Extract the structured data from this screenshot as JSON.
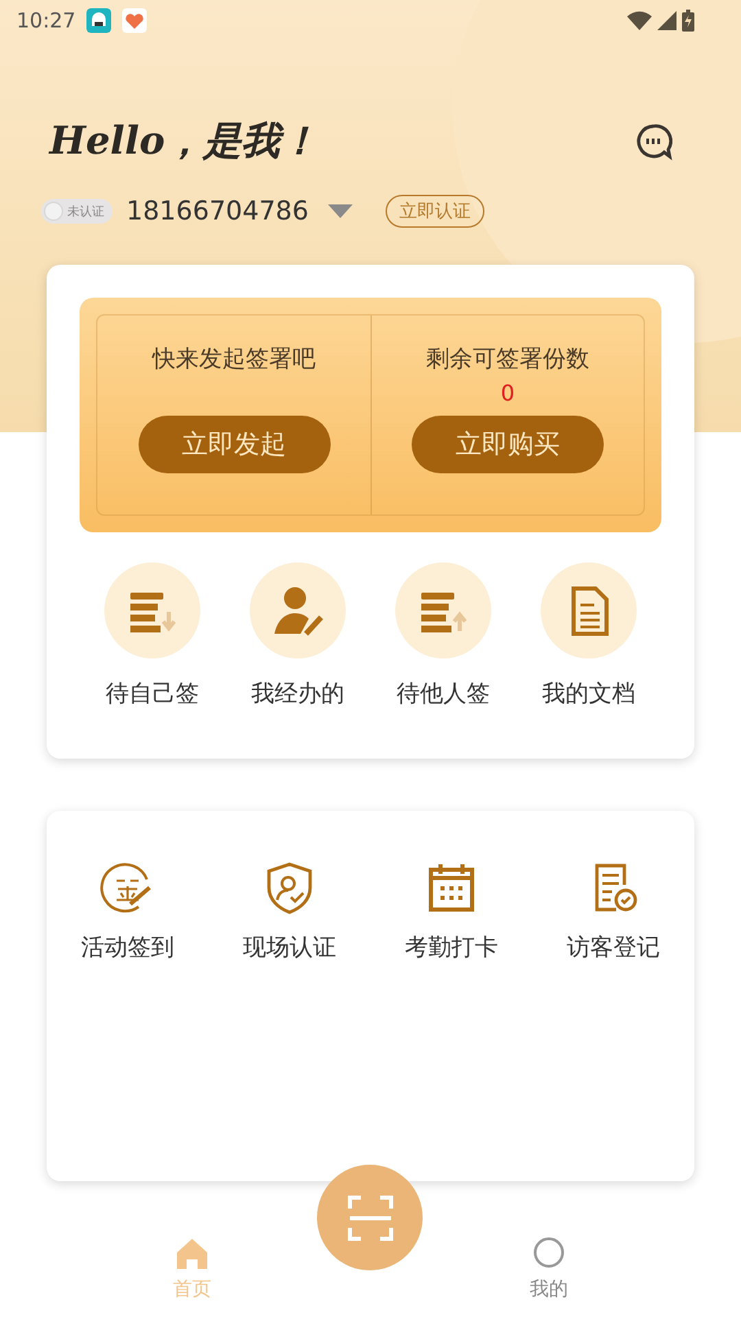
{
  "status_bar": {
    "time": "10:27"
  },
  "greeting": "Hello，是我！",
  "account": {
    "status_badge": "未认证",
    "verified": false,
    "phone": "18166704786",
    "verify_button": "立即认证"
  },
  "sign_panel": [
    {
      "kind": "start",
      "prompt": "快来发起签署吧",
      "button": "立即发起"
    },
    {
      "kind": "quota",
      "prompt": "剩余可签署份数",
      "count": "0",
      "button": "立即购买"
    }
  ],
  "quick_actions": [
    {
      "kind": "sign-in",
      "label": "待自己签"
    },
    {
      "kind": "handled",
      "label": "我经办的"
    },
    {
      "kind": "sign-out",
      "label": "待他人签"
    },
    {
      "kind": "doc",
      "label": "我的文档"
    }
  ],
  "services": [
    {
      "kind": "checkin",
      "label": "活动签到"
    },
    {
      "kind": "verify",
      "label": "现场认证"
    },
    {
      "kind": "calendar",
      "label": "考勤打卡"
    },
    {
      "kind": "visitor",
      "label": "访客登记"
    }
  ],
  "tabs": [
    {
      "kind": "home",
      "label": "首页",
      "selected": true
    },
    {
      "kind": "me",
      "label": "我的",
      "selected": false
    }
  ]
}
